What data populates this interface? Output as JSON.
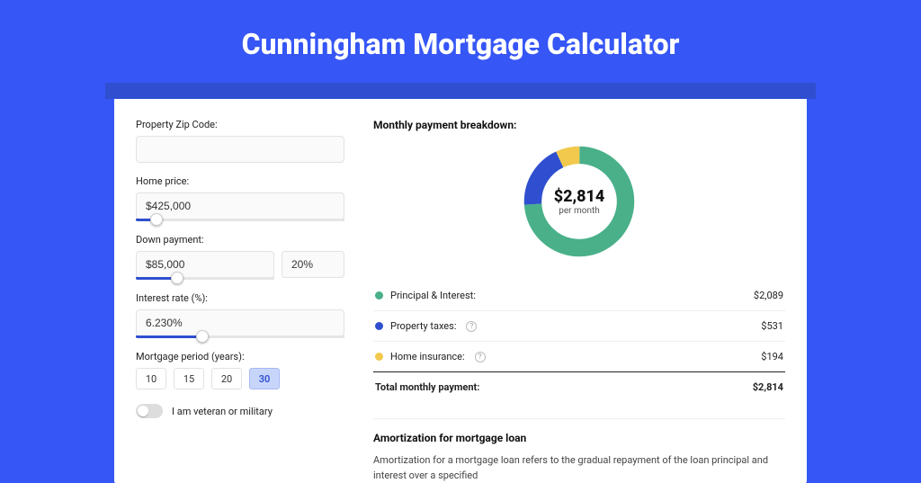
{
  "title": "Cunningham Mortgage Calculator",
  "form": {
    "zip_label": "Property Zip Code:",
    "zip_value": "",
    "home_price_label": "Home price:",
    "home_price_value": "$425,000",
    "down_payment_label": "Down payment:",
    "down_payment_value": "$85,000",
    "down_payment_pct": "20%",
    "interest_label": "Interest rate (%):",
    "interest_value": "6.230%",
    "period_label": "Mortgage period (years):",
    "periods": [
      "10",
      "15",
      "20",
      "30"
    ],
    "period_selected": "30",
    "veteran_label": "I am veteran or military"
  },
  "breakdown": {
    "title": "Monthly payment breakdown:",
    "center_amount": "$2,814",
    "center_sub": "per month",
    "rows": [
      {
        "label": "Principal & Interest:",
        "value": "$2,089",
        "color": "#49b08a",
        "info": false
      },
      {
        "label": "Property taxes:",
        "value": "$531",
        "color": "#2f4fd0",
        "info": true
      },
      {
        "label": "Home insurance:",
        "value": "$194",
        "color": "#f2c94c",
        "info": true
      }
    ],
    "total_label": "Total monthly payment:",
    "total_value": "$2,814"
  },
  "amortization": {
    "title": "Amortization for mortgage loan",
    "text": "Amortization for a mortgage loan refers to the gradual repayment of the loan principal and interest over a specified"
  },
  "chart_data": {
    "type": "pie",
    "title": "Monthly payment breakdown",
    "categories": [
      "Principal & Interest",
      "Property taxes",
      "Home insurance"
    ],
    "values": [
      2089,
      531,
      194
    ],
    "colors": [
      "#49b08a",
      "#2f4fd0",
      "#f2c94c"
    ],
    "total": 2814
  }
}
